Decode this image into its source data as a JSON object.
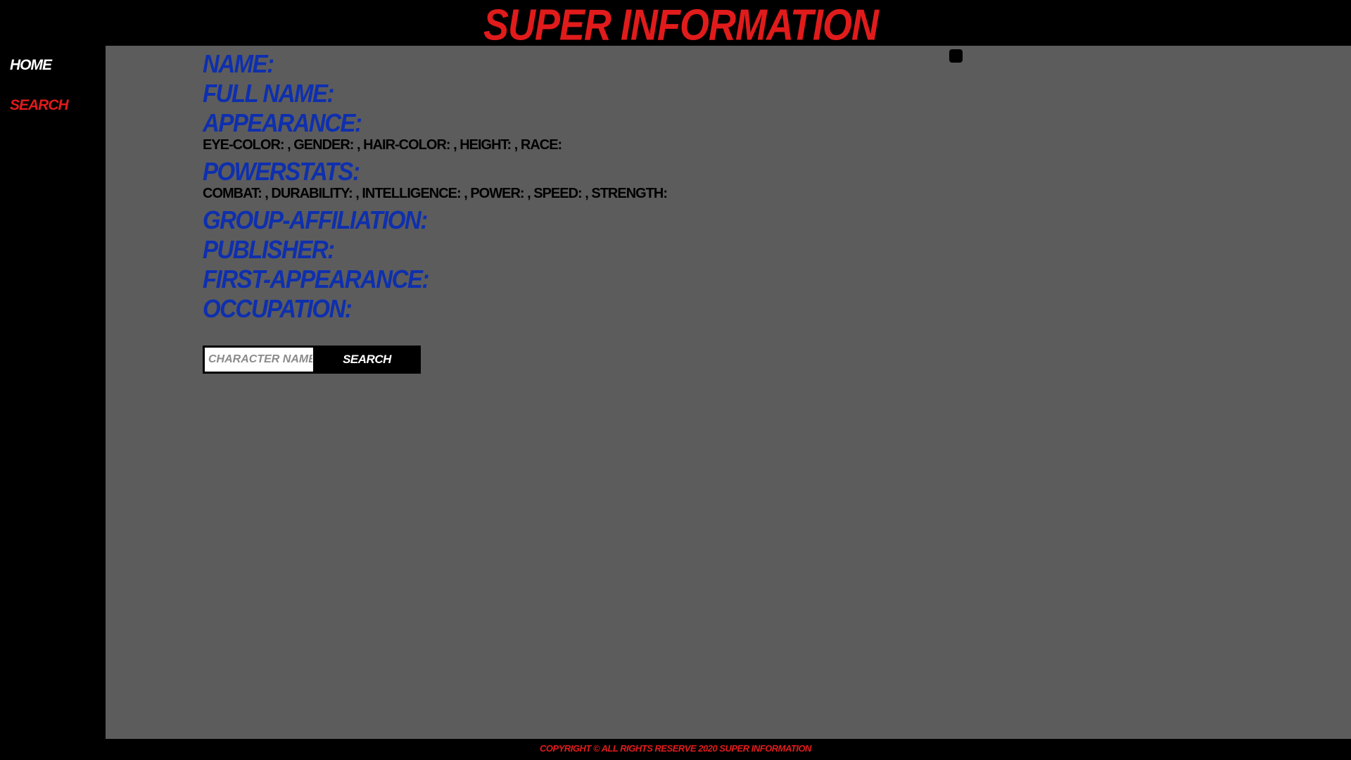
{
  "header": {
    "title": "Super Information"
  },
  "nav": {
    "items": [
      {
        "label": "Home"
      },
      {
        "label": "Search"
      }
    ]
  },
  "details": {
    "name_label": "Name:",
    "full_name_label": "Full Name:",
    "appearance_label": "Appearance:",
    "appearance_values": "eye-color: , gender: , hair-color: , height: , race:",
    "powerstats_label": "Powerstats:",
    "powerstats_values": "combat: , durability: , intelligence: , power: , speed: , strength:",
    "group_affiliation_label": "Group-Affiliation:",
    "publisher_label": "Publisher:",
    "first_appearance_label": "First-Appearance:",
    "occupation_label": "Occupation:"
  },
  "search": {
    "placeholder": "Character Name",
    "value": "",
    "button_label": "Search"
  },
  "footer": {
    "text": "Copyright © All rights reserve 2020 Super Information"
  },
  "colors": {
    "brand_red": "#e11b1b",
    "label_blue": "#0e2fae",
    "panel_gray": "#5c5c5c",
    "background": "#000000"
  }
}
